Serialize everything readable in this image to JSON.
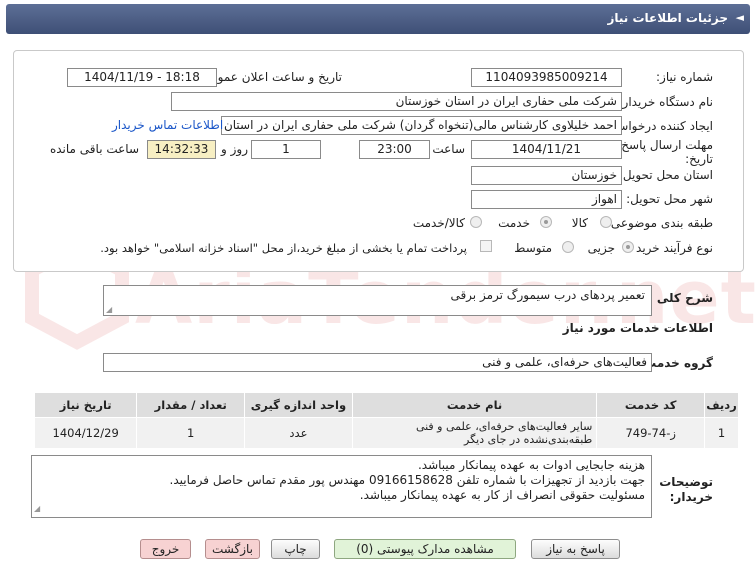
{
  "header": {
    "title": "جزئیات اطلاعات نیاز",
    "arrow": "◄"
  },
  "form": {
    "need_number_label": "شماره نیاز:",
    "need_number": "1104093985009214",
    "announce_label": "تاریخ و ساعت اعلان عمومی:",
    "announce_value": "1404/11/19 - 18:18",
    "buyer_label": "نام دستگاه خریدار:",
    "buyer_value": "شرکت ملی حفاری ایران در استان خوزستان",
    "creator_label": "ایجاد کننده درخواست:",
    "creator_value": "احمد خلیلاوی کارشناس مالی(تنخواه گردان) شرکت ملی حفاری ایران در استان",
    "contact_link": "اطلاعات تماس خریدار",
    "deadline_label": "مهلت ارسال پاسخ: تا",
    "deadline_label2": "تاریخ:",
    "deadline_date": "1404/11/21",
    "time_label": "ساعت",
    "deadline_time": "23:00",
    "days_value": "1",
    "days_label": "روز و",
    "remain_time": "14:32:33",
    "remain_label": "ساعت باقی مانده",
    "province_label": "استان محل تحویل:",
    "province_value": "خوزستان",
    "city_label": "شهر محل تحویل:",
    "city_value": "اهواز",
    "category_label": "طبقه بندی موضوعی:",
    "category_options": [
      "کالا",
      "خدمت",
      "کالا/خدمت"
    ],
    "process_label": "نوع فرآیند خرید :",
    "process_options": [
      "جزیی",
      "متوسط"
    ],
    "payment_note": "پرداخت تمام یا بخشی از مبلغ خرید،از محل \"اسناد خزانه اسلامی\" خواهد بود."
  },
  "summary": {
    "label": "شرح کلی نیاز:",
    "value": "تعمیر پردهای درب سیمورگ ترمز برقی"
  },
  "services": {
    "section_title": "اطلاعات خدمات مورد نیاز",
    "group_label": "گروه خدمت:",
    "group_value": "فعالیت‌های حرفه‌ای، علمی و فنی"
  },
  "table": {
    "headers": [
      "ردیف",
      "کد خدمت",
      "نام خدمت",
      "واحد اندازه گیری",
      "تعداد / مقدار",
      "تاریخ نیاز"
    ],
    "rows": [
      [
        "1",
        "ز-74-749",
        "سایر فعالیت‌های حرفه‌ای، علمی و فنی طبقه‌بندی‌نشده در جای دیگر",
        "عدد",
        "1",
        "1404/12/29"
      ]
    ]
  },
  "notes": {
    "label": "توضیحات خریدار:",
    "lines": [
      "هزینه جابجایی ادوات به عهده پیمانکار میباشد.",
      "جهت بازدید از تجهیزات با شماره تلفن  09166158628 مهندس پور مقدم تماس حاصل فرمایید.",
      "مسئولیت حقوقی انصراف از کار به عهده پیمانکار میباشد."
    ]
  },
  "buttons": {
    "reply": "پاسخ به نیاز",
    "view_docs": "مشاهده مدارک پیوستی (0)",
    "print": "چاپ",
    "back": "بازگشت",
    "exit": "خروج"
  },
  "watermark": "AriaTender.net",
  "colors": {
    "header": "#4a5b82",
    "link": "#1a56c8",
    "yellow_field": "#f7efc3"
  }
}
